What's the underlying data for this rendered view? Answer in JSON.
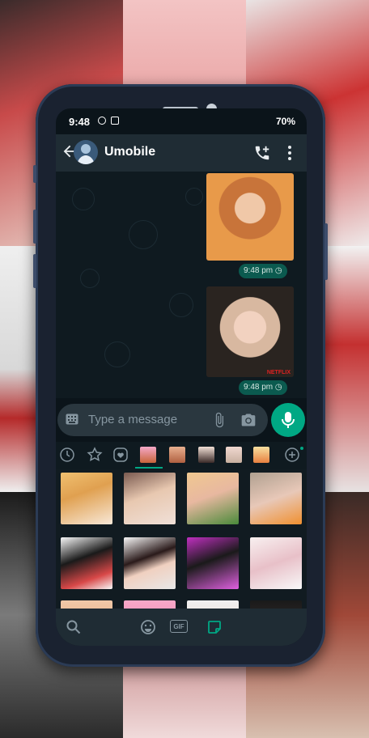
{
  "status_bar": {
    "time": "9:48",
    "battery": "70%"
  },
  "chat_header": {
    "contact_name": "Umobile"
  },
  "messages": [
    {
      "type": "sticker",
      "timestamp": "9:48 pm"
    },
    {
      "type": "sticker",
      "timestamp": "9:48 pm",
      "watermark": "NETFLIX"
    }
  ],
  "composer": {
    "placeholder": "Type a message"
  },
  "sticker_tabs": [
    "recent",
    "favorites",
    "heart",
    "pack-1",
    "pack-2",
    "pack-3",
    "pack-4",
    "pack-5",
    "add"
  ],
  "bottom_bar": {
    "gif_label": "GIF"
  },
  "colors": {
    "accent": "#00a884",
    "header": "#1f2c34",
    "chat_bg": "#0b141a",
    "input": "#2a373f",
    "timestamp_bubble": "#0b5a4f"
  }
}
